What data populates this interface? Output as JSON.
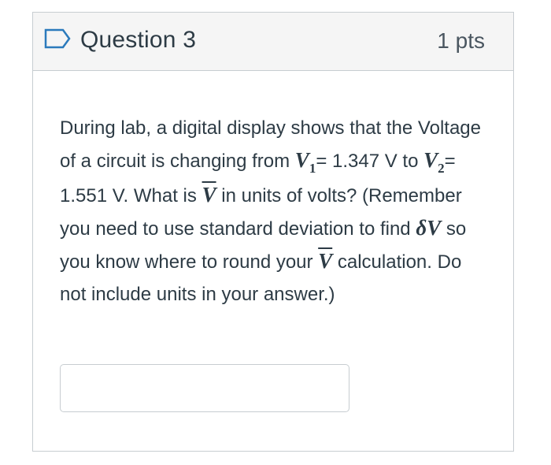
{
  "question": {
    "title": "Question 3",
    "points": "1 pts"
  },
  "body": {
    "t1": "During lab, a digital display shows that the Voltage of a circuit is changing from ",
    "v1_var": "V",
    "v1_sub": "1",
    "t2": "= 1.347 V to ",
    "v2_var": "V",
    "v2_sub": "2",
    "t3": "= 1.551 V.  What is ",
    "vbar": "V",
    "t4": " in units of volts?   (Remember you need to use standard deviation to find ",
    "delta_v": "δV",
    "t5": " so you know where to round your ",
    "vbar2": "V",
    "t6": " calculation. Do not include units in your answer.)"
  },
  "answer": {
    "value": "",
    "placeholder": ""
  },
  "colors": {
    "header_bg": "#f5f5f5",
    "border": "#c7cdd1",
    "bookmark": "#2b7abc",
    "text": "#2d3b45"
  },
  "icons": {
    "bookmark": "bookmark-outline-icon"
  }
}
